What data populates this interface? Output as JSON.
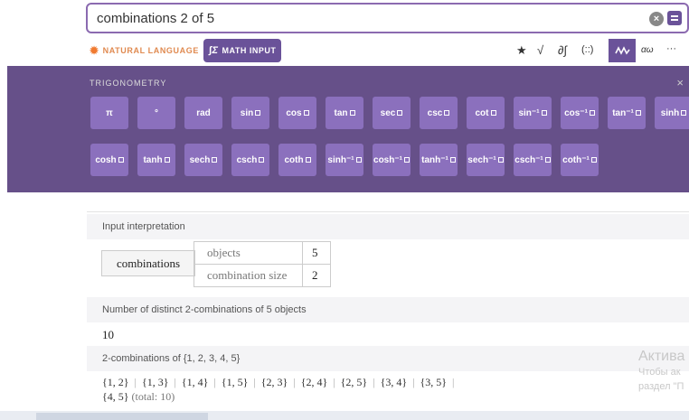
{
  "search": {
    "query": "combinations 2 of 5"
  },
  "modes": {
    "natural_language": "NATURAL LANGUAGE",
    "math_input": "MATH INPUT"
  },
  "toolbar": [
    "star-icon",
    "sqrt-icon",
    "integral-icon",
    "matrix-icon",
    "trig-icon",
    "greek-icon",
    "more-icon"
  ],
  "toolbar_labels": {
    "star": "★",
    "sqrt": "√",
    "integral": "∂∫",
    "matrix": "(::)",
    "greek": "αω",
    "more": "···"
  },
  "palette": {
    "title": "TRIGONOMETRY",
    "row1": [
      "π",
      "°",
      "rad",
      "sin",
      "cos",
      "tan",
      "sec",
      "csc",
      "cot",
      "sin⁻¹",
      "cos⁻¹",
      "tan⁻¹",
      "sinh"
    ],
    "row2": [
      "cosh",
      "tanh",
      "sech",
      "csch",
      "coth",
      "sinh⁻¹",
      "cosh⁻¹",
      "tanh⁻¹",
      "sech⁻¹",
      "csch⁻¹",
      "coth⁻¹"
    ]
  },
  "result": {
    "interp_title": "Input interpretation",
    "interp_main": "combinations",
    "interp_rows": [
      {
        "label": "objects",
        "value": "5"
      },
      {
        "label": "combination size",
        "value": "2"
      }
    ],
    "count_title": "Number of distinct 2-combinations of 5 objects",
    "count_value": "10",
    "combos_title": "2-combinations of {1, 2, 3, 4, 5}",
    "combos": [
      "{1, 2}",
      "{1, 3}",
      "{1, 4}",
      "{1, 5}",
      "{2, 3}",
      "{2, 4}",
      "{2, 5}",
      "{3, 4}",
      "{3, 5}",
      "{4, 5}"
    ],
    "total": "(total: 10)"
  },
  "watermark": {
    "title": "Актива",
    "line1": "Чтобы ак",
    "line2": "раздел \"П"
  }
}
